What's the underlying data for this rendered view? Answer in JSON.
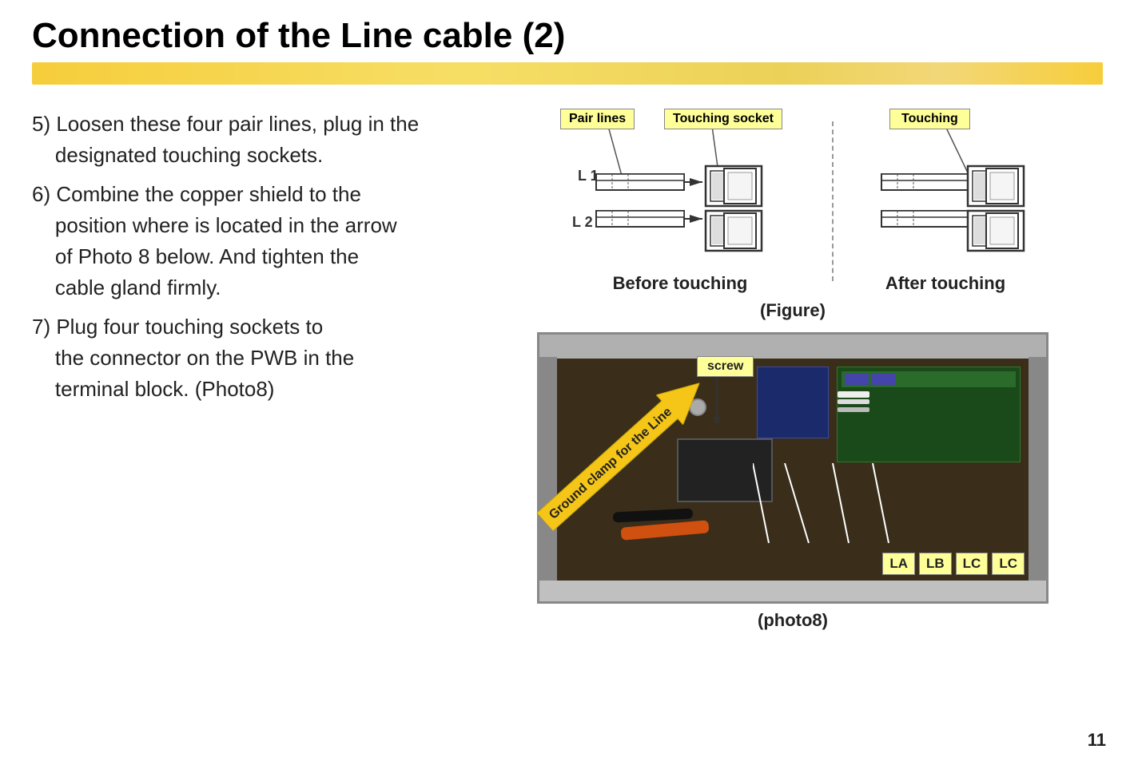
{
  "page": {
    "title": "Connection of the Line cable (2)",
    "page_number": "11"
  },
  "instructions": [
    {
      "id": "step5",
      "text": "5) Loosen these four pair lines, plug in the    designated touching sockets."
    },
    {
      "id": "step6",
      "text": "6) Combine the copper shield to the    position where is located in the arrow    of Photo 8 below. And tighten the    cable gland firmly."
    },
    {
      "id": "step7",
      "text": "7) Plug four touching sockets to    the connector on the PWB in the    terminal block. (Photo8)"
    }
  ],
  "figure": {
    "pair_lines_label": "Pair lines",
    "touching_socket_label": "Touching socket",
    "touching_label": "Touching",
    "L1_label": "L 1",
    "L2_label": "L 2",
    "before_touching_label": "Before touching",
    "after_touching_label": "After touching",
    "figure_caption": "(Figure)"
  },
  "photo": {
    "screw_label": "screw",
    "ground_clamp_label": "Ground clamp for the Line",
    "connectors": [
      "LA",
      "LB",
      "LC",
      "LC"
    ],
    "photo_caption": "(photo8)"
  }
}
